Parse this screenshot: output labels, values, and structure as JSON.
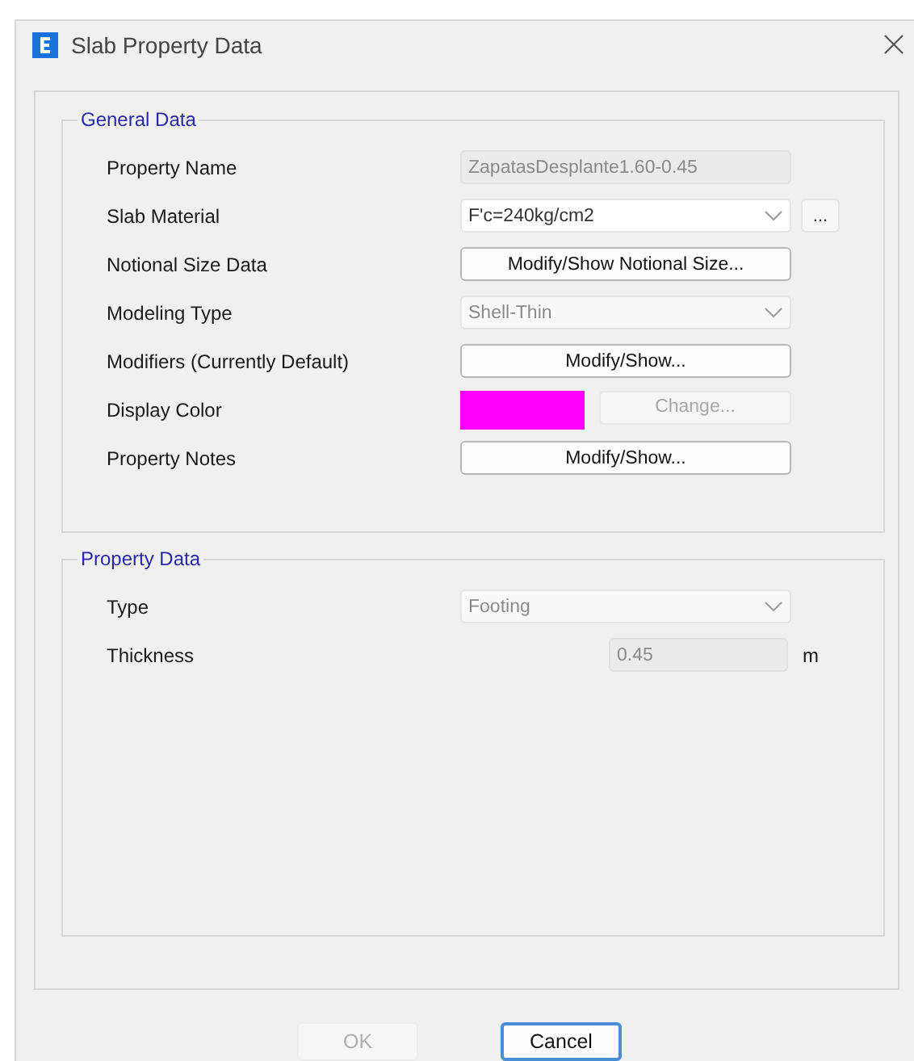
{
  "window": {
    "title": "Slab Property Data"
  },
  "groups": [
    {
      "title": "General Data",
      "rows": [
        {
          "label": "Property Name",
          "kind": "text",
          "value": "ZapatasDesplante1.60-0.45",
          "disabled": true
        },
        {
          "label": "Slab Material",
          "kind": "dropdown",
          "value": "F'c=240kg/cm2",
          "disabled": false,
          "extra_button": "..."
        },
        {
          "label": "Notional Size Data",
          "kind": "button",
          "value": "Modify/Show Notional Size...",
          "disabled": false
        },
        {
          "label": "Modeling Type",
          "kind": "dropdown",
          "value": "Shell-Thin",
          "disabled": true
        },
        {
          "label": "Modifiers (Currently Default)",
          "kind": "button",
          "value": "Modify/Show...",
          "disabled": false
        },
        {
          "label": "Display Color",
          "kind": "color",
          "color": "#ff00ff",
          "value": "Change...",
          "disabled": true
        },
        {
          "label": "Property Notes",
          "kind": "button",
          "value": "Modify/Show...",
          "disabled": false
        }
      ]
    },
    {
      "title": "Property Data",
      "rows": [
        {
          "label": "Type",
          "kind": "dropdown",
          "value": "Footing",
          "disabled": true
        },
        {
          "label": "Thickness",
          "kind": "short-text",
          "value": "0.45",
          "unit": "m",
          "disabled": true
        }
      ]
    }
  ],
  "buttons": [
    {
      "label": "OK",
      "disabled": true,
      "focused": false
    },
    {
      "label": "Cancel",
      "disabled": false,
      "focused": true
    }
  ]
}
